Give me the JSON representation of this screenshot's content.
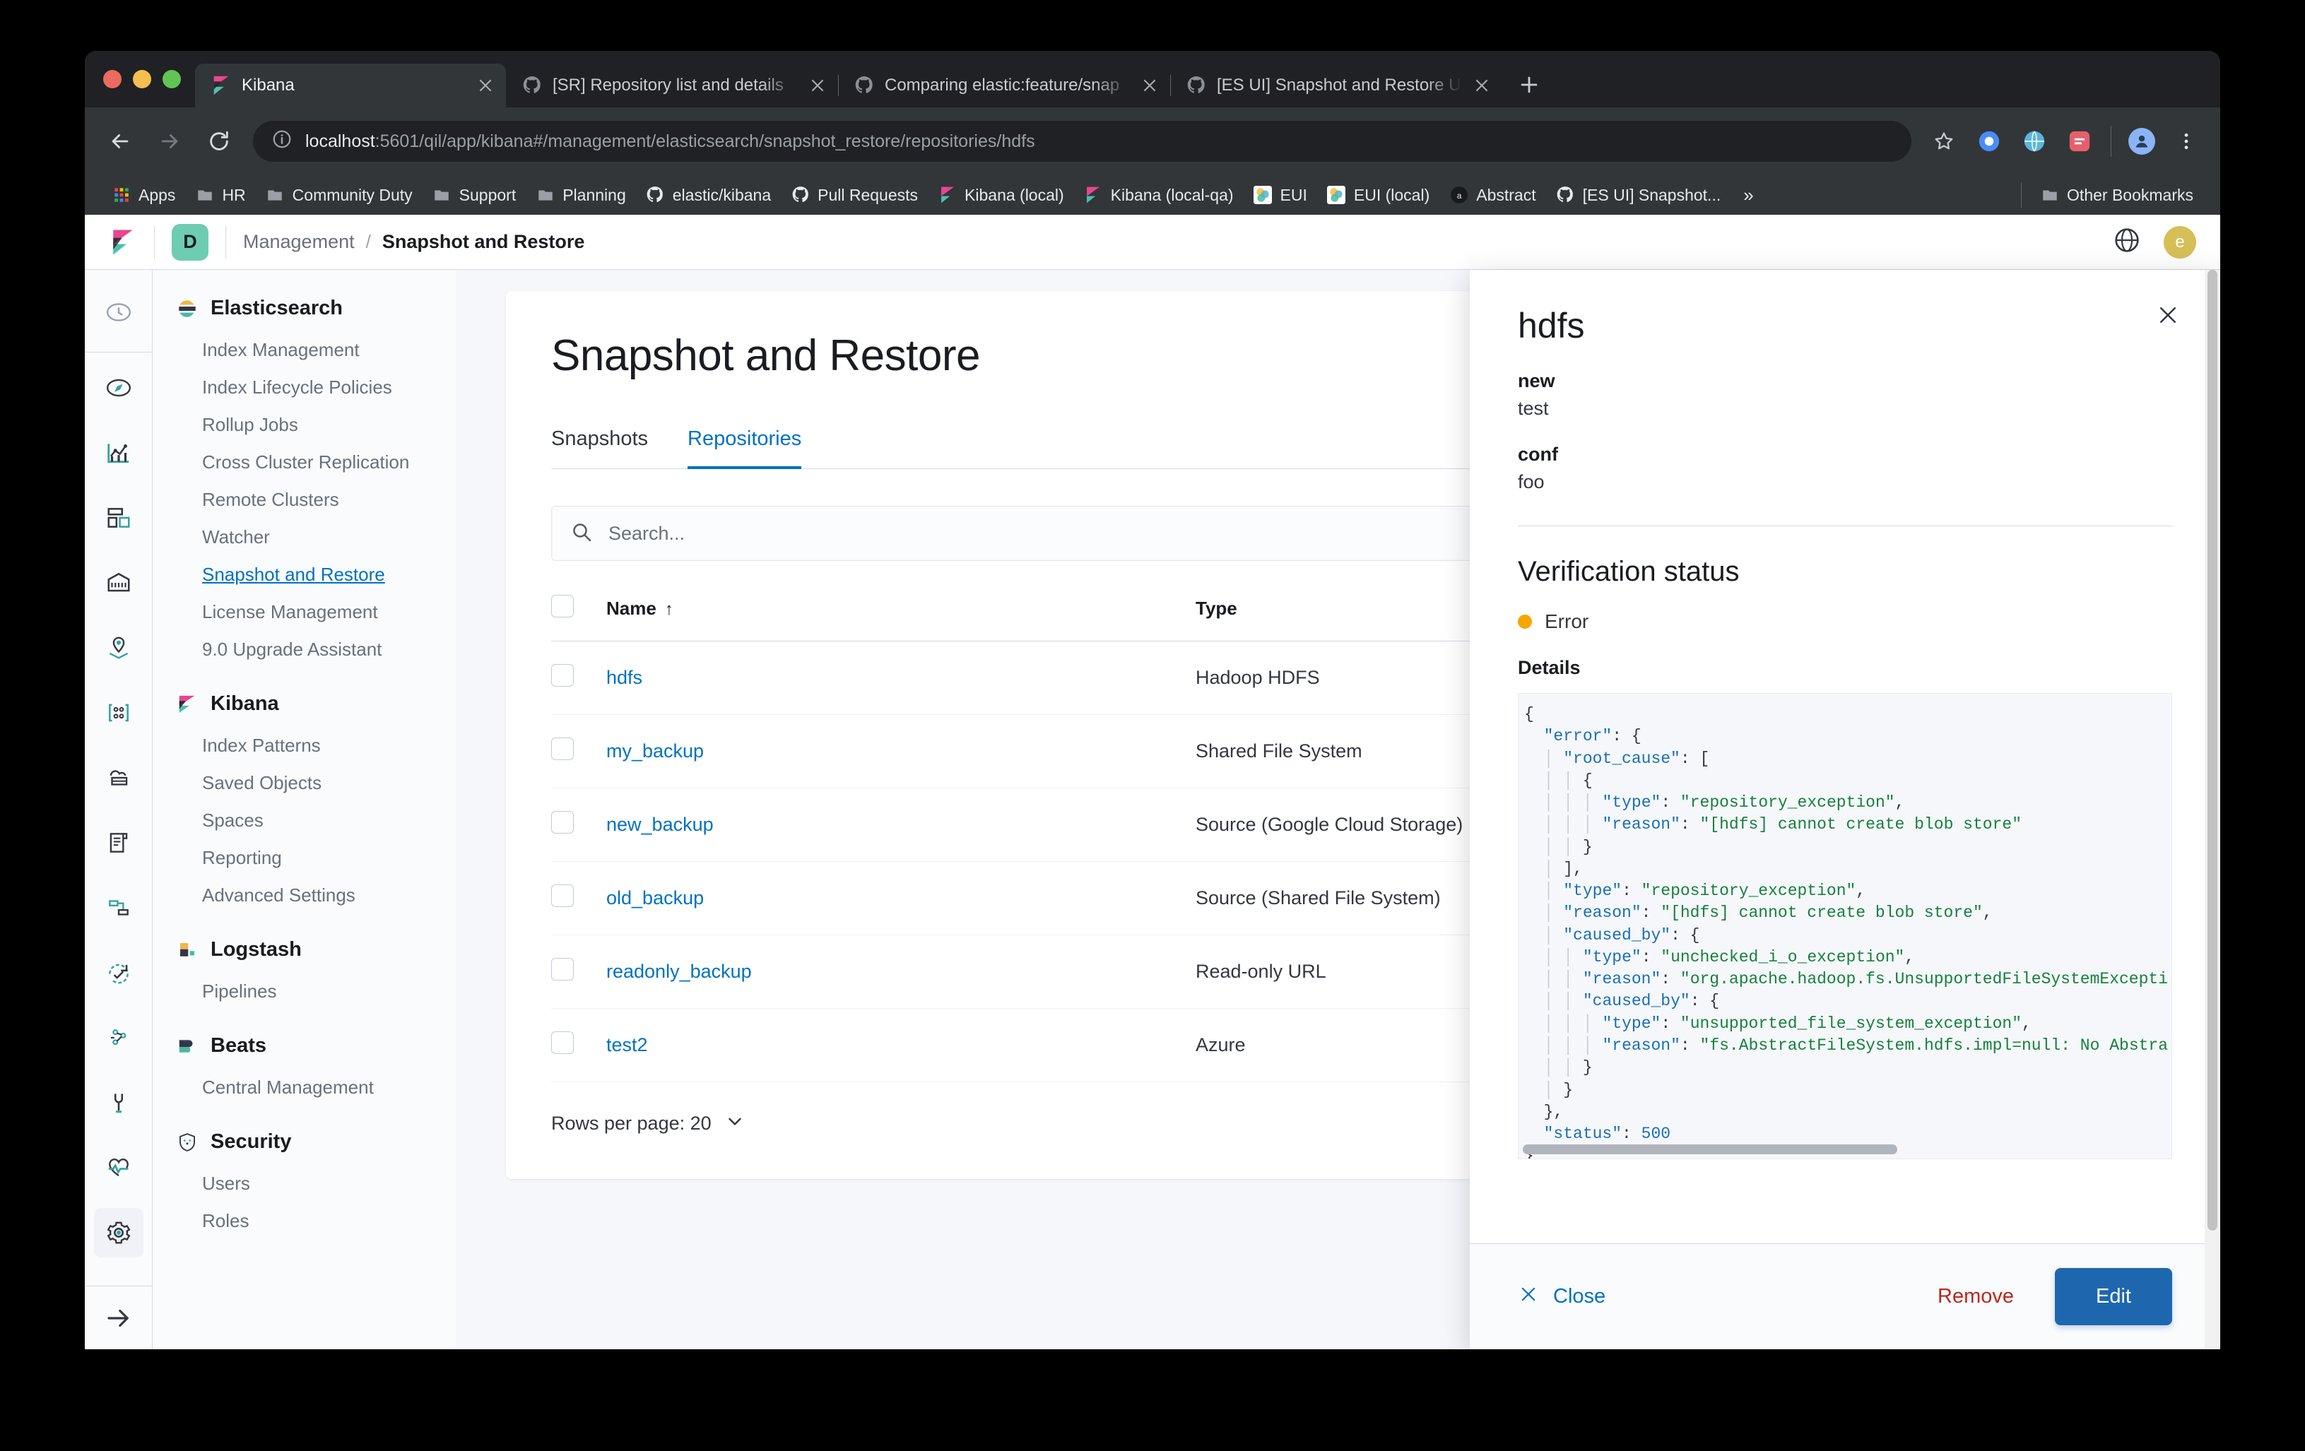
{
  "browser": {
    "tabs": [
      {
        "title": "Kibana",
        "favicon": "kibana-logo",
        "active": true
      },
      {
        "title": "[SR] Repository list and details",
        "favicon": "github-logo",
        "active": false
      },
      {
        "title": "Comparing elastic:feature/snap",
        "favicon": "github-logo",
        "active": false
      },
      {
        "title": "[ES UI] Snapshot and Restore U",
        "favicon": "github-logo",
        "active": false
      }
    ],
    "new_tab_label": "+",
    "url_host": "localhost",
    "url_path": ":5601/qil/app/kibana#/management/elasticsearch/snapshot_restore/repositories/hdfs",
    "bookmarks": [
      {
        "label": "Apps",
        "icon": "apps-grid-icon"
      },
      {
        "label": "HR",
        "icon": "folder-icon"
      },
      {
        "label": "Community Duty",
        "icon": "folder-icon"
      },
      {
        "label": "Support",
        "icon": "folder-icon"
      },
      {
        "label": "Planning",
        "icon": "folder-icon"
      },
      {
        "label": "elastic/kibana",
        "icon": "github-logo"
      },
      {
        "label": "Pull Requests",
        "icon": "github-logo"
      },
      {
        "label": "Kibana (local)",
        "icon": "kibana-logo"
      },
      {
        "label": "Kibana (local-qa)",
        "icon": "kibana-logo"
      },
      {
        "label": "EUI",
        "icon": "eui-logo"
      },
      {
        "label": "EUI (local)",
        "icon": "eui-logo"
      },
      {
        "label": "Abstract",
        "icon": "abstract-logo"
      },
      {
        "label": "[ES UI] Snapshot...",
        "icon": "github-logo"
      }
    ],
    "bookmarks_overflow": "»",
    "other_bookmarks": {
      "label": "Other Bookmarks",
      "icon": "folder-icon"
    }
  },
  "kibana": {
    "space_badge": "D",
    "breadcrumbs": [
      {
        "label": "Management",
        "current": false
      },
      {
        "label": "Snapshot and Restore",
        "current": true
      }
    ],
    "avatar_initial": "e",
    "rail": [
      {
        "name": "recently-viewed-icon",
        "active": false
      },
      {
        "name": "discover-icon",
        "active": false
      },
      {
        "name": "visualize-icon",
        "active": false
      },
      {
        "name": "dashboard-icon",
        "active": false
      },
      {
        "name": "canvas-icon",
        "active": false
      },
      {
        "name": "maps-icon",
        "active": false
      },
      {
        "name": "machine-learning-icon",
        "active": false
      },
      {
        "name": "infrastructure-icon",
        "active": false
      },
      {
        "name": "logs-icon",
        "active": false
      },
      {
        "name": "apm-icon",
        "active": false
      },
      {
        "name": "uptime-icon",
        "active": false
      },
      {
        "name": "siem-icon",
        "active": false
      },
      {
        "name": "dev-tools-icon",
        "active": false
      },
      {
        "name": "monitoring-icon",
        "active": false
      },
      {
        "name": "management-gear-icon",
        "active": true
      }
    ],
    "rail_collapse_label": "→",
    "nav": [
      {
        "title": "Elasticsearch",
        "icon": "elasticsearch-logo",
        "items": [
          {
            "label": "Index Management",
            "selected": false
          },
          {
            "label": "Index Lifecycle Policies",
            "selected": false
          },
          {
            "label": "Rollup Jobs",
            "selected": false
          },
          {
            "label": "Cross Cluster Replication",
            "selected": false
          },
          {
            "label": "Remote Clusters",
            "selected": false
          },
          {
            "label": "Watcher",
            "selected": false
          },
          {
            "label": "Snapshot and Restore",
            "selected": true
          },
          {
            "label": "License Management",
            "selected": false
          },
          {
            "label": "9.0 Upgrade Assistant",
            "selected": false
          }
        ]
      },
      {
        "title": "Kibana",
        "icon": "kibana-logo",
        "items": [
          {
            "label": "Index Patterns",
            "selected": false
          },
          {
            "label": "Saved Objects",
            "selected": false
          },
          {
            "label": "Spaces",
            "selected": false
          },
          {
            "label": "Reporting",
            "selected": false
          },
          {
            "label": "Advanced Settings",
            "selected": false
          }
        ]
      },
      {
        "title": "Logstash",
        "icon": "logstash-logo",
        "items": [
          {
            "label": "Pipelines",
            "selected": false
          }
        ]
      },
      {
        "title": "Beats",
        "icon": "beats-logo",
        "items": [
          {
            "label": "Central Management",
            "selected": false
          }
        ]
      },
      {
        "title": "Security",
        "icon": "security-shield-logo",
        "items": [
          {
            "label": "Users",
            "selected": false
          },
          {
            "label": "Roles",
            "selected": false
          }
        ]
      }
    ]
  },
  "main": {
    "page_title": "Snapshot and Restore",
    "tabs": [
      {
        "label": "Snapshots",
        "active": false
      },
      {
        "label": "Repositories",
        "active": true
      }
    ],
    "search_placeholder": "Search...",
    "table": {
      "columns": [
        "Name",
        "Type"
      ],
      "sort_column": "Name",
      "sort_direction": "asc",
      "sort_arrow": "↑",
      "rows": [
        {
          "name": "hdfs",
          "type": "Hadoop HDFS"
        },
        {
          "name": "my_backup",
          "type": "Shared File System"
        },
        {
          "name": "new_backup",
          "type": "Source (Google Cloud Storage)"
        },
        {
          "name": "old_backup",
          "type": "Source (Shared File System)"
        },
        {
          "name": "readonly_backup",
          "type": "Read-only URL"
        },
        {
          "name": "test2",
          "type": "Azure"
        }
      ]
    },
    "rows_per_page_label": "Rows per page: 20"
  },
  "flyout": {
    "title": "hdfs",
    "fields": [
      {
        "key": "new",
        "value": "test"
      },
      {
        "key": "conf",
        "value": "foo"
      }
    ],
    "verification_heading": "Verification status",
    "status": "Error",
    "status_color": "#F5A700",
    "details_label": "Details",
    "details_json_lines": [
      "{",
      "  \"error\": {",
      "    \"root_cause\": [",
      "      {",
      "        \"type\": \"repository_exception\",",
      "        \"reason\": \"[hdfs] cannot create blob store\"",
      "      }",
      "    ],",
      "    \"type\": \"repository_exception\",",
      "    \"reason\": \"[hdfs] cannot create blob store\",",
      "    \"caused_by\": {",
      "      \"type\": \"unchecked_i_o_exception\",",
      "      \"reason\": \"org.apache.hadoop.fs.UnsupportedFileSystemExcepti",
      "      \"caused_by\": {",
      "        \"type\": \"unsupported_file_system_exception\",",
      "        \"reason\": \"fs.AbstractFileSystem.hdfs.impl=null: No Abstra",
      "      }",
      "    }",
      "  },",
      "  \"status\": 500",
      "}"
    ],
    "footer": {
      "close_label": "Close",
      "remove_label": "Remove",
      "edit_label": "Edit"
    }
  }
}
